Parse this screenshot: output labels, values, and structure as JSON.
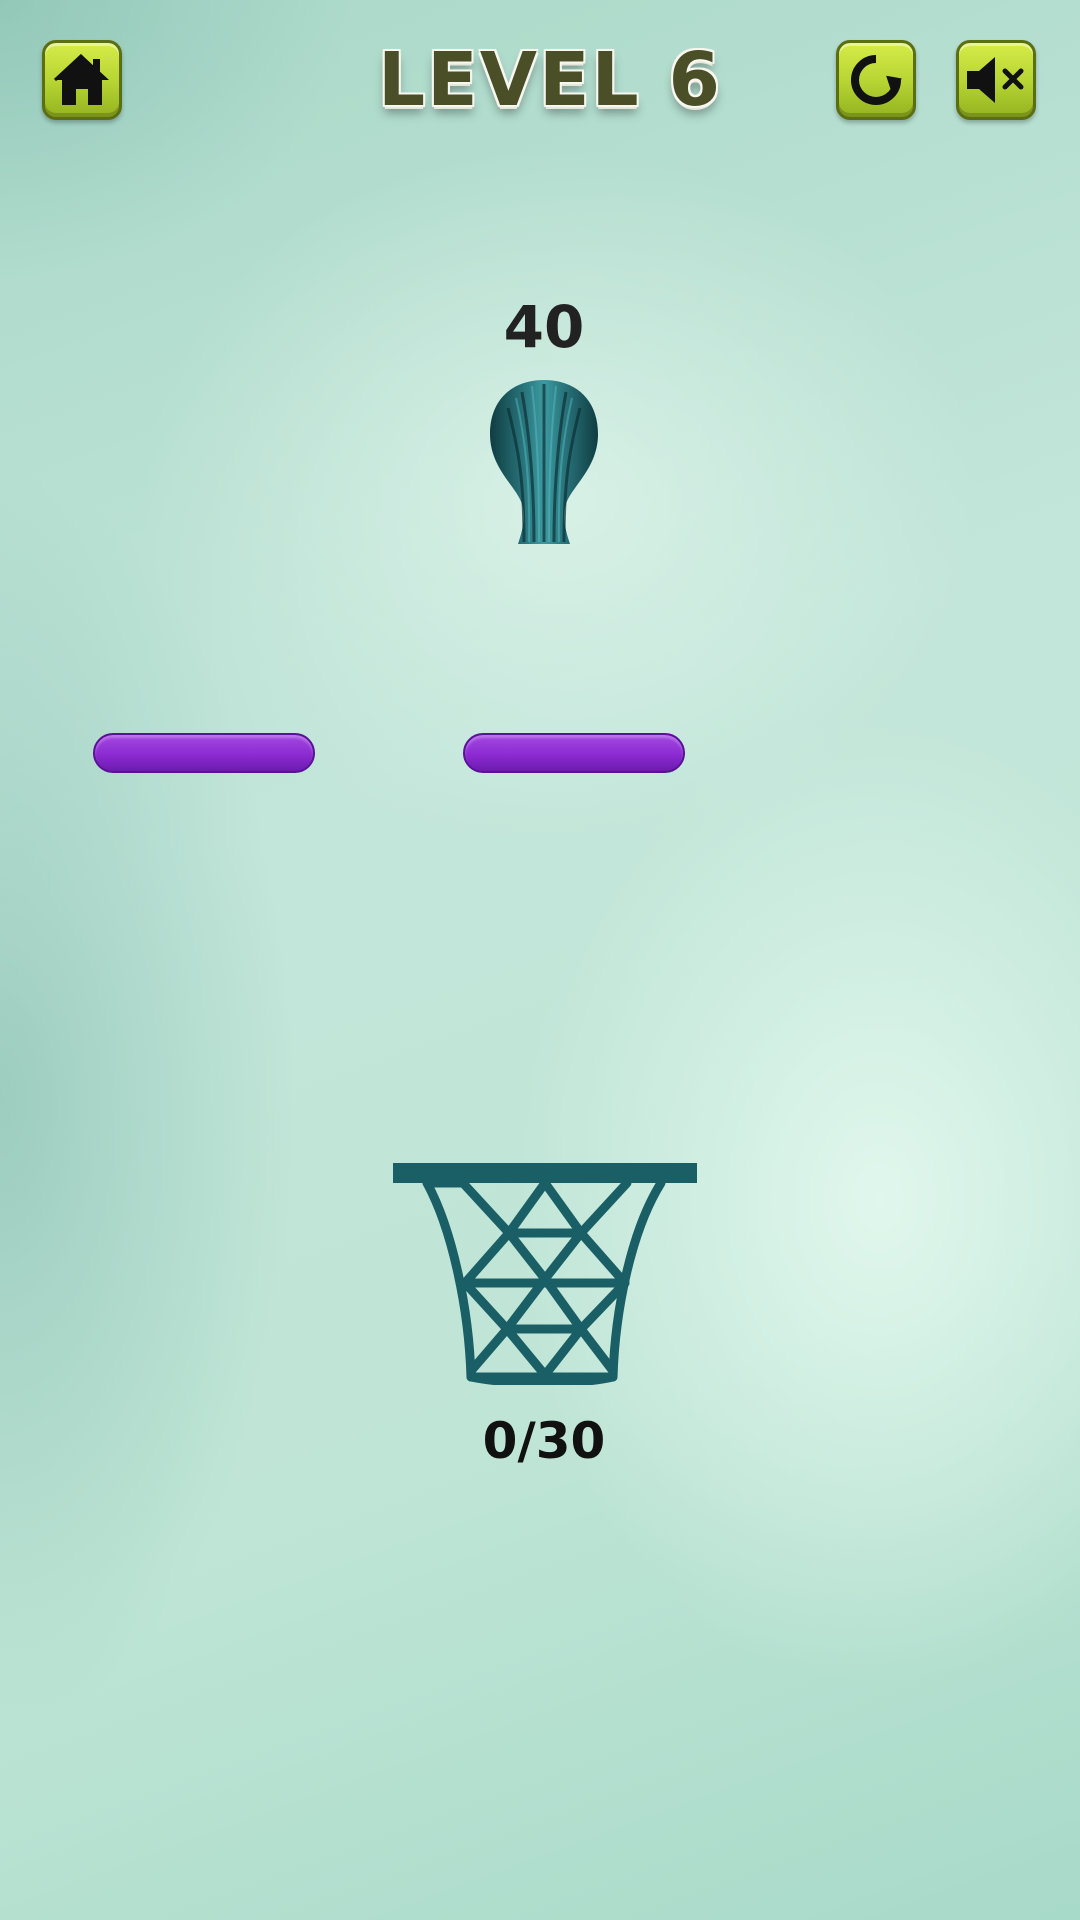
{
  "header": {
    "level_title": "LEVEL 6",
    "buttons": [
      {
        "name": "home-button",
        "icon": "home-icon"
      },
      {
        "name": "restart-button",
        "icon": "restart-icon"
      },
      {
        "name": "mute-button",
        "icon": "speaker-muted-icon"
      }
    ]
  },
  "game": {
    "score": "40",
    "counter": "0/30",
    "projectile_icon": "shuttlecock-icon",
    "target_icon": "basketball-hoop-icon",
    "platform_count": 2
  },
  "colors": {
    "button_fill": "#c1dc3a",
    "button_border": "#5b6e12",
    "platform": "#8b2bd1",
    "hoop": "#1a5f66",
    "shuttle": "#1f5d63",
    "background": "#bfe3d6"
  }
}
